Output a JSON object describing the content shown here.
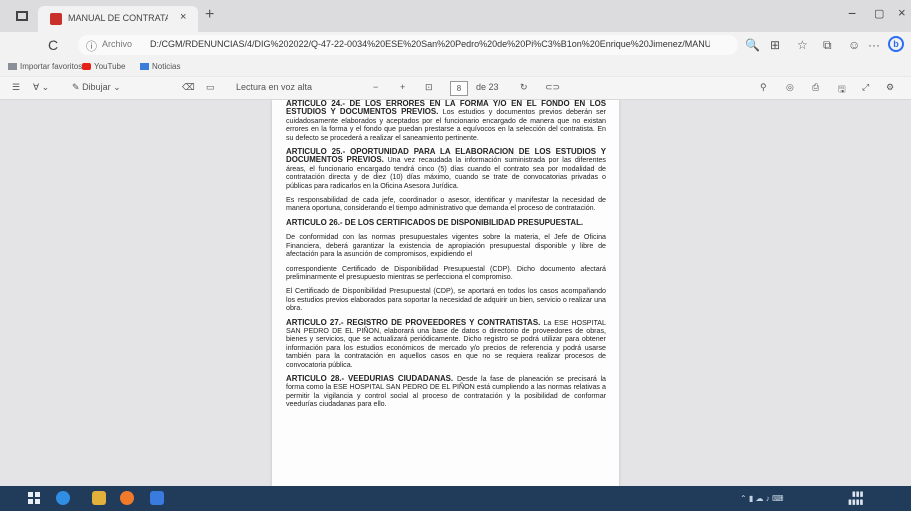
{
  "window": {
    "tab_title": "MANUAL DE CONTRATACION ...",
    "tab_close": "×",
    "new_tab": "+",
    "minimize": "−",
    "maximize": "▢",
    "close": "×"
  },
  "address_bar": {
    "refresh": "C",
    "info": "ⓘ",
    "scheme": "Archivo",
    "url": "D:/CGM/RDENUNCIAS/4/DIG%202022/Q-47-22-0034%20ESE%20San%20Pedro%20de%20Pi%C3%B1on%20Enrique%20Jimenez/MANU...",
    "zoom_icon": "🔍",
    "read_icon": "⊞",
    "favorite_icon": "☆",
    "collections_icon": "⧉",
    "profile_icon": "☺",
    "more_icon": "···",
    "bing_icon": "b"
  },
  "favorites_bar": {
    "items": [
      "Importar favoritos",
      "YouTube",
      "Noticias"
    ]
  },
  "pdf_toolbar": {
    "draw_icon": "✎",
    "draw_label": "Dibujar",
    "erase_icon": "⌫",
    "view_icon": "▭",
    "read_aloud": "Lectura en voz alta",
    "zoom_out": "−",
    "zoom_in": "+",
    "fit_icon": "⊡",
    "page_current": "8",
    "page_total": "de 23",
    "rotate_icon": "↻",
    "search_icon": "⚲",
    "settings_icon": "⚙"
  },
  "document": {
    "paragraphs": [
      {
        "heading": "ARTICULO 24.- DE LOS ERRORES EN LA FORMA Y/O EN EL FONDO EN LOS ESTUDIOS Y DOCUMENTOS PREVIOS.",
        "body": "Los estudios y documentos previos deberán ser cuidadosamente elaborados y aceptados por el funcionario encargado de manera que no existan errores en la forma y el fondo que puedan prestarse a equívocos en la selección del contratista. En su defecto se procederá a realizar el saneamiento pertinente."
      },
      {
        "heading": "ARTICULO 25.- OPORTUNIDAD PARA LA ELABORACION DE LOS ESTUDIOS Y DOCUMENTOS PREVIOS.",
        "body": "Una vez recaudada la información suministrada por las diferentes áreas, el funcionario encargado tendrá cinco (5) días cuando el contrato sea por modalidad de contratación directa y de diez (10) días máximo, cuando se trate de convocatorias privadas o públicas para radicarlos en la Oficina Asesora Jurídica."
      },
      {
        "heading": "",
        "body": "Es responsabilidad de cada jefe, coordinador o asesor, identificar y manifestar la necesidad de manera oportuna, considerando el tiempo administrativo que demanda el proceso de contratación."
      },
      {
        "heading": "ARTICULO 26.- DE LOS CERTIFICADOS DE DISPONIBILIDAD PRESUPUESTAL.",
        "body": ""
      },
      {
        "heading": "",
        "body": "De conformidad con las normas presupuestales vigentes sobre la materia, el Jefe de Oficina Financiera, deberá garantizar la existencia de apropiación presupuestal disponible y libre de afectación para la asunción de compromisos, expidiendo el"
      },
      {
        "heading": "",
        "body": "correspondiente Certificado de Disponibilidad Presupuestal (CDP). Dicho documento afectará preliminarmente el presupuesto mientras se perfecciona el compromiso."
      },
      {
        "heading": "",
        "body": "El Certificado de Disponibilidad Presupuestal (CDP), se aportará en todos los casos acompañando los estudios previos elaborados para soportar la necesidad de adquirir un bien, servicio o realizar una obra."
      },
      {
        "heading": "ARTICULO 27.- REGISTRO DE PROVEEDORES Y CONTRATISTAS.",
        "body": "La ESE HOSPITAL SAN PEDRO DE EL PIÑON, elaborará una base de datos o directorio de proveedores de obras, bienes y servicios, que se actualizará periódicamente. Dicho registro se podrá utilizar para obtener información para los estudios económicos de mercado y/o precios de referencia y podrá usarse también para la contratación en aquellos casos en que no se requiera realizar procesos de convocatoria pública."
      },
      {
        "heading": "ARTICULO 28.- VEEDURIAS CIUDADANAS.",
        "body": "Desde la fase de planeación se precisará la forma como la ESE HOSPITAL SAN PEDRO DE EL PIÑON está cumpliendo a las normas relativas a permitir la vigilancia y control social al proceso de contratación y la posibilidad de conformar veedurías ciudadanas para ello."
      }
    ]
  },
  "colors": {
    "titlebar": "#dcdcdf",
    "taskbar": "#213c5a",
    "pdf_accent": "#c9302c",
    "bing_blue": "#2a6df4"
  }
}
